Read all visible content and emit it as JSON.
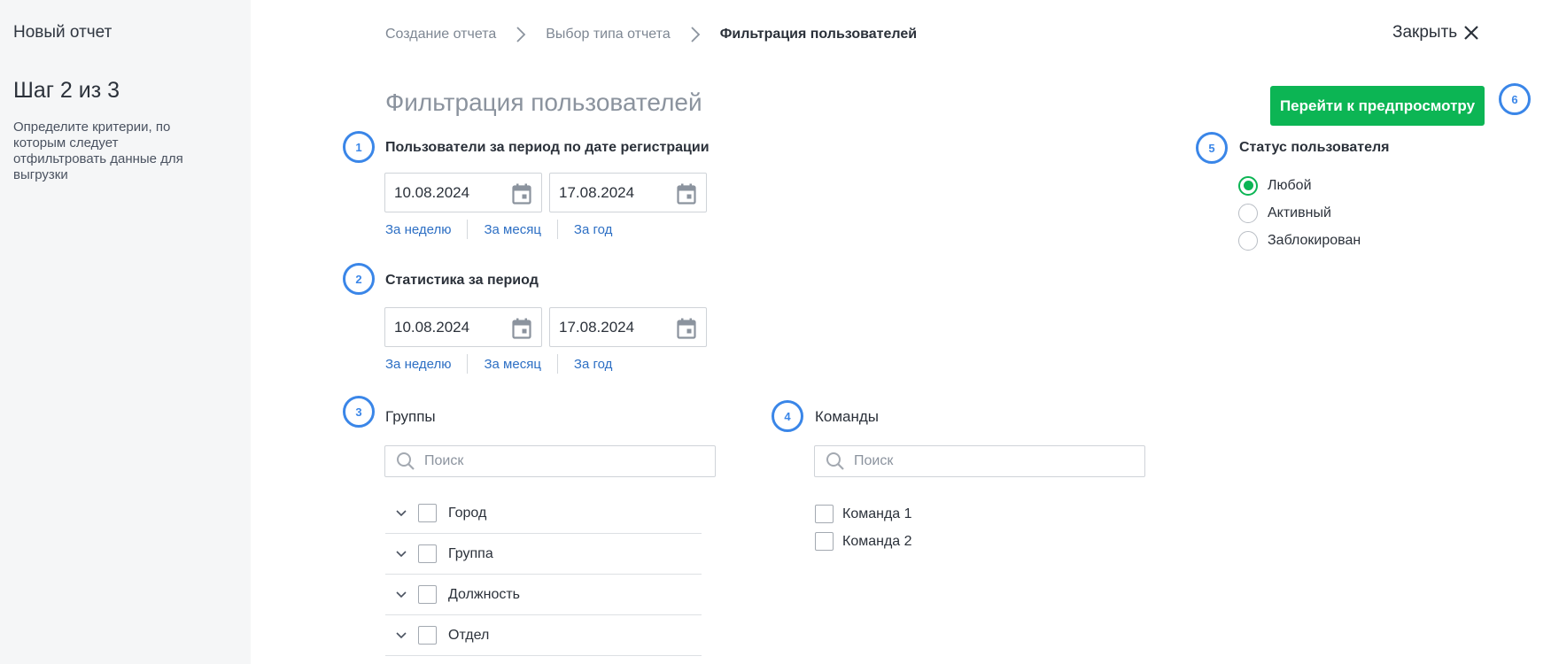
{
  "sidebar": {
    "title": "Новый отчет",
    "step": "Шаг 2 из 3",
    "description": "Определите критерии, по которым следует отфильтровать данные для выгрузки"
  },
  "breadcrumbs": [
    "Создание отчета",
    "Выбор типа отчета",
    "Фильтрация пользователей"
  ],
  "close_label": "Закрыть",
  "page_title": "Фильтрация пользователей",
  "preview_button": "Перейти к предпросмотру",
  "markers": [
    "1",
    "2",
    "3",
    "4",
    "5",
    "6"
  ],
  "quick_ranges": [
    "За неделю",
    "За месяц",
    "За год"
  ],
  "registration": {
    "label": "Пользователи за период по дате регистрации",
    "from": "10.08.2024",
    "to": "17.08.2024"
  },
  "statistics": {
    "label": "Статистика за период",
    "from": "10.08.2024",
    "to": "17.08.2024"
  },
  "groups": {
    "label": "Группы",
    "search_placeholder": "Поиск",
    "items": [
      "Город",
      "Группа",
      "Должность",
      "Отдел"
    ]
  },
  "teams": {
    "label": "Команды",
    "search_placeholder": "Поиск",
    "items": [
      "Команда 1",
      "Команда 2"
    ]
  },
  "status": {
    "label": "Статус пользователя",
    "options": [
      "Любой",
      "Активный",
      "Заблокирован"
    ],
    "selected": "Любой"
  },
  "colors": {
    "accent_green": "#0cb554",
    "marker_blue": "#3a86e8",
    "link_blue": "#2d6fc4",
    "sidebar_bg": "#f5f6f7"
  },
  "icons": {
    "close": "close-icon",
    "breadcrumb_separator": "chevron-right-icon",
    "date": "calendar-icon",
    "search": "search-icon",
    "expand": "chevron-down-icon"
  }
}
